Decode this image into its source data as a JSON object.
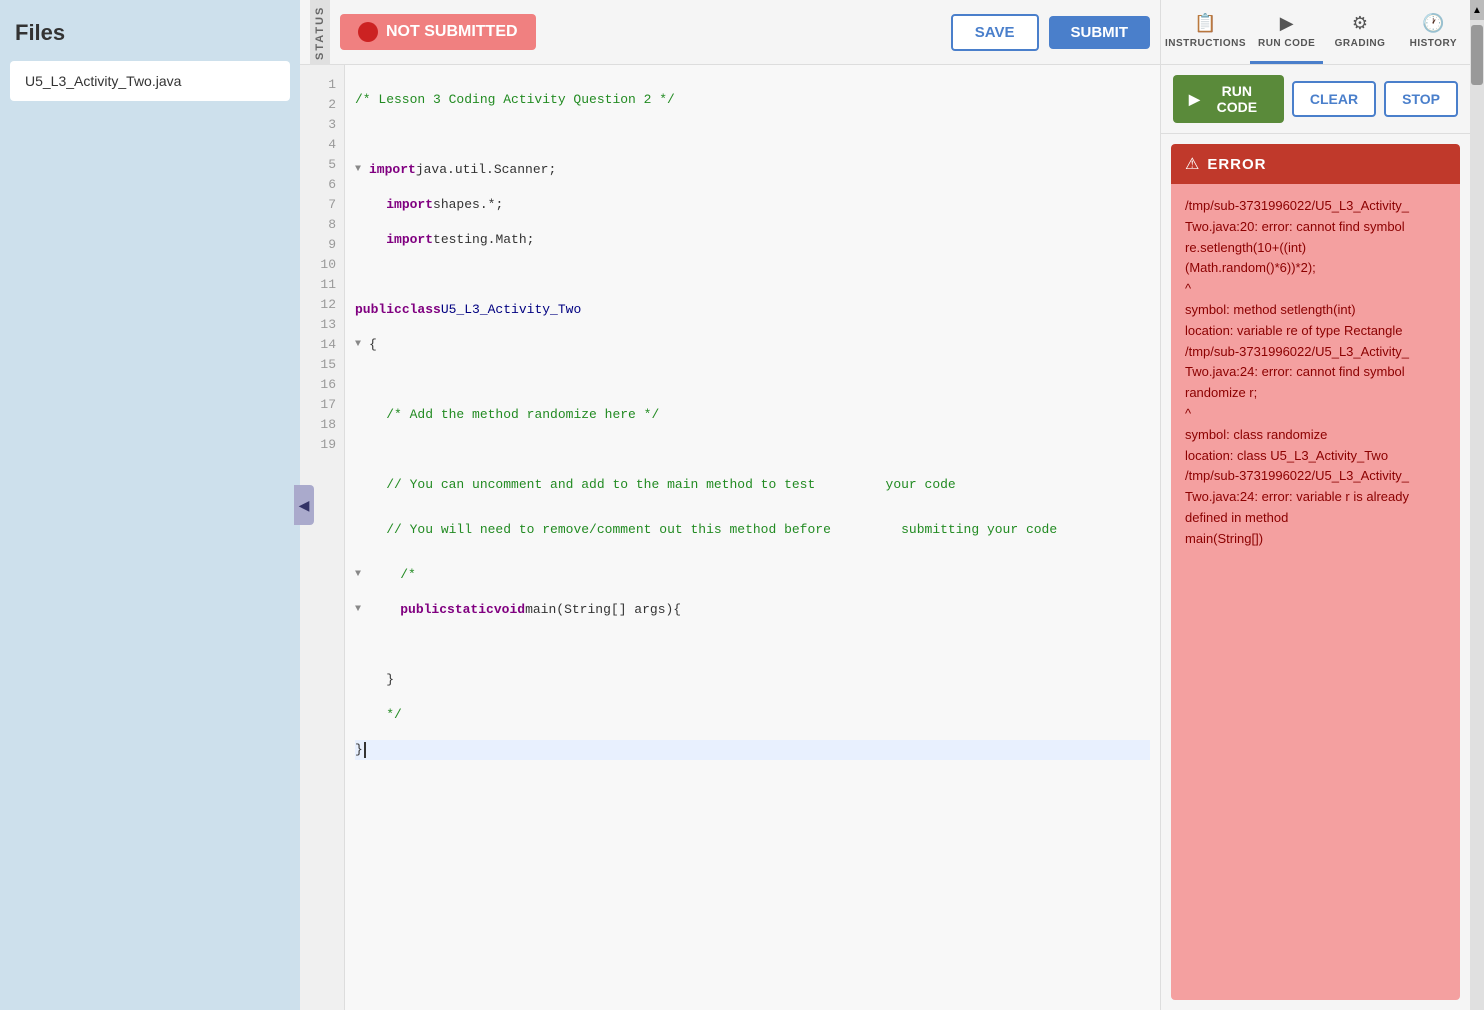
{
  "files": {
    "title": "Files",
    "items": [
      {
        "name": "U5_L3_Activity_Two.java"
      }
    ]
  },
  "status": {
    "label": "STATUS",
    "badge_text": "NOT SUBMITTED",
    "badge_bg": "#f08080"
  },
  "toolbar": {
    "save_label": "SAVE",
    "submit_label": "SUBMIT"
  },
  "code": {
    "lines": [
      {
        "num": 1,
        "fold": false,
        "content": "/* Lesson 3 Coding Activity Question 2 */",
        "type": "comment"
      },
      {
        "num": 2,
        "fold": false,
        "content": "",
        "type": "blank"
      },
      {
        "num": 3,
        "fold": true,
        "content": "import java.util.Scanner;",
        "type": "import"
      },
      {
        "num": 4,
        "fold": false,
        "content": "import shapes.*;",
        "type": "import"
      },
      {
        "num": 5,
        "fold": false,
        "content": "import testing.Math;",
        "type": "import"
      },
      {
        "num": 6,
        "fold": false,
        "content": "",
        "type": "blank"
      },
      {
        "num": 7,
        "fold": false,
        "content": "public class U5_L3_Activity_Two",
        "type": "class"
      },
      {
        "num": 8,
        "fold": true,
        "content": "{",
        "type": "bracket"
      },
      {
        "num": 9,
        "fold": false,
        "content": "",
        "type": "blank"
      },
      {
        "num": 10,
        "fold": false,
        "content": "    /* Add the method randomize here */",
        "type": "comment"
      },
      {
        "num": 11,
        "fold": false,
        "content": "",
        "type": "blank"
      },
      {
        "num": 12,
        "fold": false,
        "content": "    // You can uncomment and add to the main method to test\n         your code",
        "type": "comment"
      },
      {
        "num": 13,
        "fold": false,
        "content": "    // You will need to remove/comment out this method before\n         submitting your code",
        "type": "comment"
      },
      {
        "num": 14,
        "fold": true,
        "content": "    /*",
        "type": "comment"
      },
      {
        "num": 15,
        "fold": true,
        "content": "    public static void main(String[] args){",
        "type": "method"
      },
      {
        "num": 16,
        "fold": false,
        "content": "",
        "type": "blank"
      },
      {
        "num": 17,
        "fold": false,
        "content": "    }",
        "type": "bracket"
      },
      {
        "num": 18,
        "fold": false,
        "content": "    */",
        "type": "comment"
      },
      {
        "num": 19,
        "fold": false,
        "content": "}",
        "type": "bracket_end",
        "highlighted": true
      }
    ]
  },
  "right_panel": {
    "tabs": [
      {
        "id": "instructions",
        "label": "INSTRUCTIONS",
        "icon": "📋"
      },
      {
        "id": "run_code",
        "label": "RUN CODE",
        "icon": "▶"
      },
      {
        "id": "grading",
        "label": "GRADING",
        "icon": "⚙"
      },
      {
        "id": "history",
        "label": "HISTORY",
        "icon": "🕐"
      }
    ],
    "active_tab": "run_code",
    "run_code_btn": "RUN CODE",
    "clear_btn": "CLEAR",
    "stop_btn": "STOP",
    "error": {
      "header": "ERROR",
      "body": "/tmp/sub-3731996022/U5_L3_Activity_Two.java:20: error: cannot find symbol\nre.setlength(10+((int)(Math.random()*6))*2);\n^\nsymbol: method setlength(int)\nlocation: variable re of type Rectangle\n/tmp/sub-3731996022/U5_L3_Activity_Two.java:24: error: cannot find symbol\nrandomize r;\n^\nsymbol: class randomize\nlocation: class U5_L3_Activity_Two\n/tmp/sub-3731996022/U5_L3_Activity_Two.java:24: error: variable r is already defined in method\nmain(String[])"
    }
  }
}
